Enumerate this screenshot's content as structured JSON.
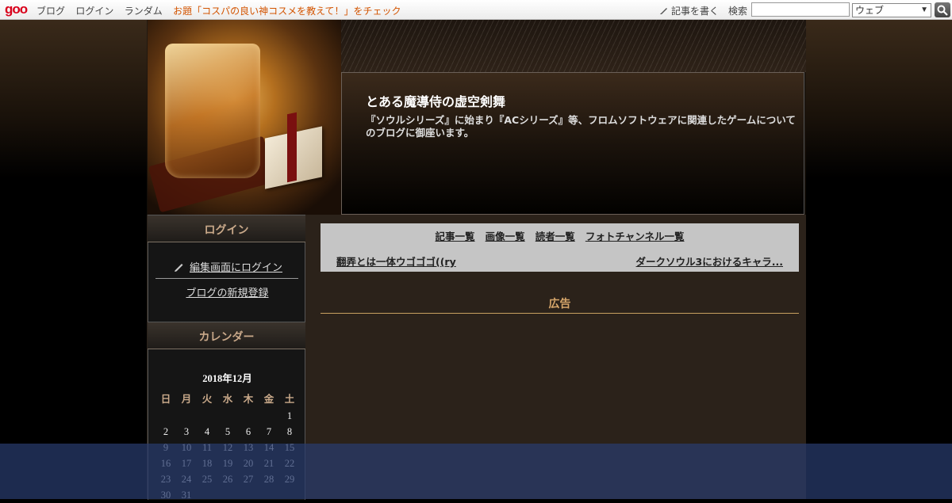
{
  "topbar": {
    "logo": "goo",
    "nav": [
      "ブログ",
      "ログイン",
      "ランダム"
    ],
    "promo": "お題「コスパの良い神コスメを教えて！」をチェック",
    "write": "記事を書く",
    "search_label": "検索",
    "search_value": "",
    "search_scope": "ウェブ"
  },
  "header": {
    "title": "とある魔導侍の虚空剣舞",
    "description": "『ソウルシリーズ』に始まり『ACシリーズ』等、フロムソフトウェアに関連したゲームについてのブログに御座います。"
  },
  "sidebar": {
    "login_heading": "ログイン",
    "login_link": "編集画面にログイン",
    "register_link": "ブログの新規登録",
    "calendar_heading": "カレンダー",
    "calendar": {
      "month": "2018年12月",
      "weekdays": [
        "日",
        "月",
        "火",
        "水",
        "木",
        "金",
        "土"
      ],
      "weeks": [
        [
          "",
          "",
          "",
          "",
          "",
          "",
          "1"
        ],
        [
          "2",
          "3",
          "4",
          "5",
          "6",
          "7",
          "8"
        ],
        [
          "9",
          "10",
          "11",
          "12",
          "13",
          "14",
          "15"
        ],
        [
          "16",
          "17",
          "18",
          "19",
          "20",
          "21",
          "22"
        ],
        [
          "23",
          "24",
          "25",
          "26",
          "27",
          "28",
          "29"
        ],
        [
          "30",
          "31",
          "",
          "",
          "",
          "",
          ""
        ]
      ]
    }
  },
  "main": {
    "nav_links": [
      "記事一覧",
      "画像一覧",
      "読者一覧",
      "フォトチャンネル一覧"
    ],
    "prev_article": "翻弄とは一体ウゴゴゴ((ry",
    "next_article": "ダークソウル3におけるキャラ...",
    "ad_heading": "広告"
  },
  "colors": {
    "accent": "#d6a66a",
    "promo": "#d35400",
    "overlay": "#283c6e"
  }
}
